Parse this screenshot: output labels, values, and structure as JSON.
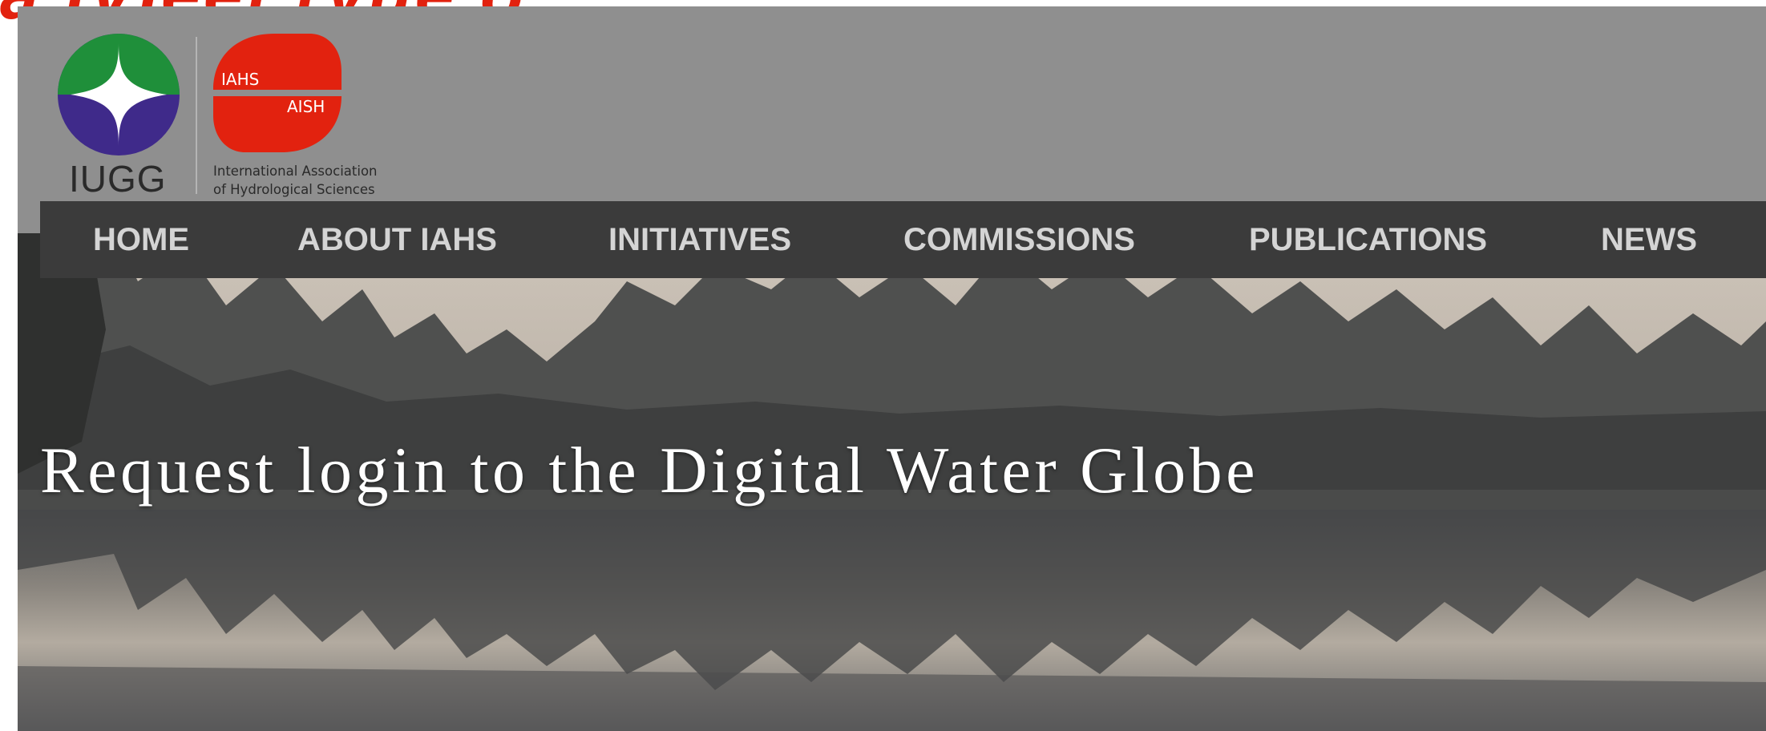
{
  "top_banner": {
    "partial_text": "a IVIeet ryue o"
  },
  "header": {
    "iugg_label": "IUGG",
    "iahs_logo_text_left": "IAHS",
    "iahs_logo_text_right": "AISH",
    "iahs_name_line1": "International Association",
    "iahs_name_line2": "of Hydrological Sciences"
  },
  "nav": {
    "items": [
      {
        "label": "HOME"
      },
      {
        "label": "ABOUT IAHS"
      },
      {
        "label": "INITIATIVES"
      },
      {
        "label": "COMMISSIONS"
      },
      {
        "label": "PUBLICATIONS"
      },
      {
        "label": "NEWS"
      }
    ]
  },
  "hero": {
    "title": "Request login to the Digital Water Globe"
  },
  "colors": {
    "header_bg": "#8f8f8f",
    "nav_bg": "#3b3b3b",
    "nav_text": "#d4d4d4",
    "iugg_green": "#1f8f3a",
    "iugg_purple": "#3f2a8a",
    "iahs_red": "#e2220f",
    "top_text_red": "#e2220f"
  }
}
